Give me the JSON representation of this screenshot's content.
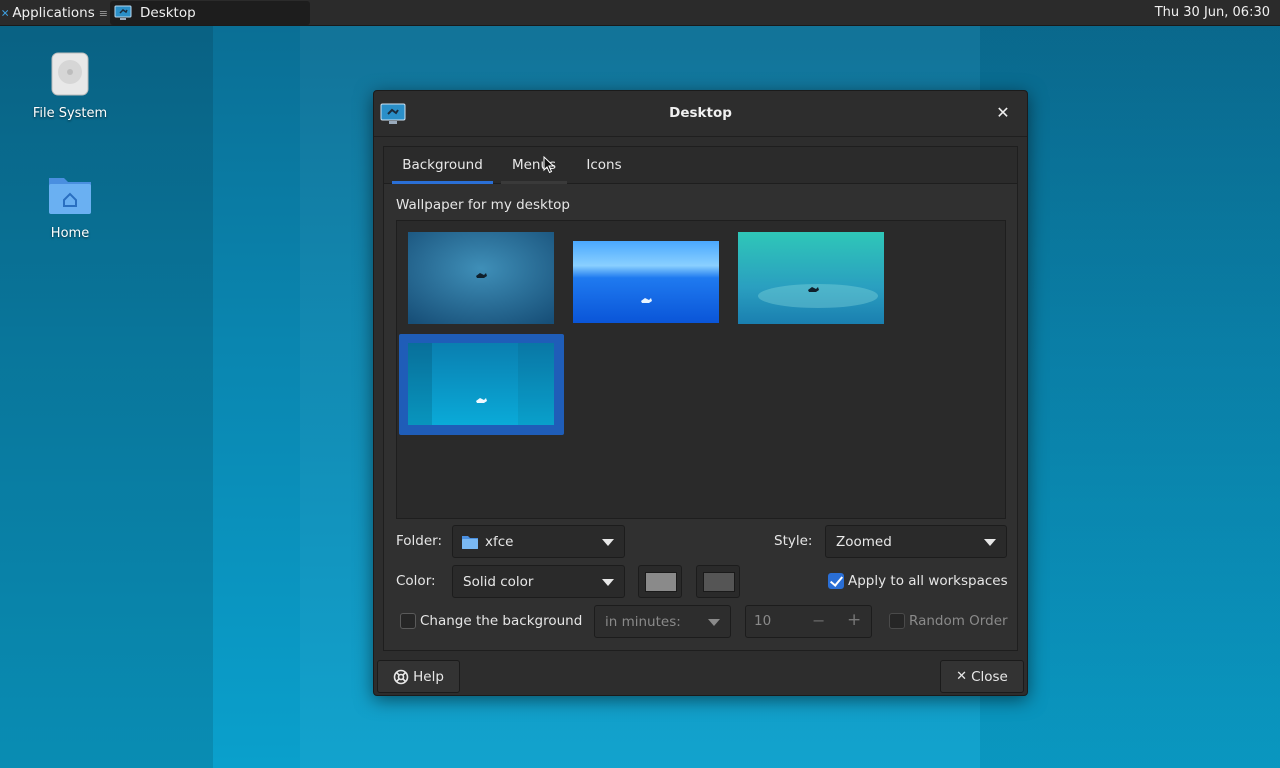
{
  "panel": {
    "applications_label": "Applications",
    "task_label": "Desktop",
    "clock": "Thu 30 Jun, 06:30"
  },
  "desktop": {
    "icons": [
      {
        "label": "File System",
        "icon": "drive-icon"
      },
      {
        "label": "Home",
        "icon": "home-folder-icon"
      }
    ]
  },
  "dialog": {
    "title": "Desktop",
    "tabs": [
      {
        "label": "Background",
        "active": true
      },
      {
        "label": "Menus",
        "active": false
      },
      {
        "label": "Icons",
        "active": false
      }
    ],
    "wallpaper_label": "Wallpaper for my desktop",
    "wallpapers": [
      {
        "name": "xfce-wallpaper-1",
        "selected": false
      },
      {
        "name": "xfce-wallpaper-2",
        "selected": false
      },
      {
        "name": "xfce-wallpaper-3",
        "selected": false
      },
      {
        "name": "xfce-wallpaper-4",
        "selected": true
      }
    ],
    "folder_label": "Folder:",
    "folder_value": "xfce",
    "style_label": "Style:",
    "style_value": "Zoomed",
    "color_label": "Color:",
    "color_value": "Solid color",
    "color_swatch_1": "#8a8a8a",
    "color_swatch_2": "#555555",
    "apply_all_label": "Apply to all workspaces",
    "apply_all_checked": true,
    "change_bg_label": "Change the background",
    "change_bg_checked": false,
    "interval_unit": "in minutes:",
    "interval_value": "10",
    "random_order_label": "Random Order",
    "random_order_checked": false,
    "help_label": "Help",
    "close_label": "Close"
  },
  "colors": {
    "accent": "#2a6fd6",
    "dialog_bg": "#2d2d2d",
    "panel_bg": "#2b2b2b"
  }
}
